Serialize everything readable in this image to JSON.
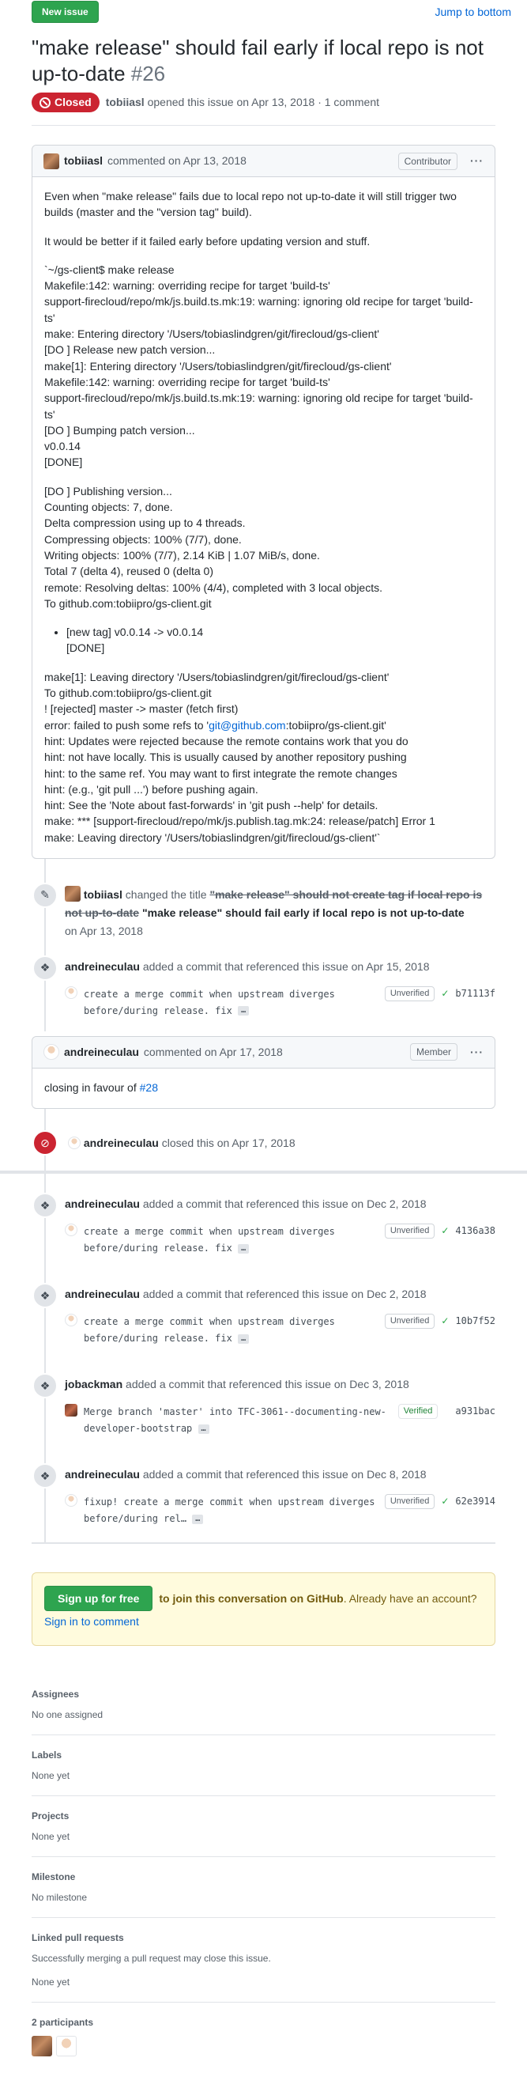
{
  "header": {
    "new_issue": "New issue",
    "jump": "Jump to bottom",
    "title": "\"make release\" should fail early if local repo is not up-to-date",
    "number": "#26",
    "state": "Closed",
    "author": "tobiiasl",
    "opened_text": "opened this issue on Apr 13, 2018 · 1 comment"
  },
  "first_comment": {
    "author": "tobiiasl",
    "action": "commented on Apr 13, 2018",
    "role": "Contributor",
    "menu": "···",
    "p1": "Even when \"make release\" fails due to local repo not up-to-date it will still trigger two builds (master and the \"version tag\" build).",
    "p2": "It would be better if it failed early before updating version and stuff.",
    "block1": [
      "`~/gs-client$ make release",
      "Makefile:142: warning: overriding recipe for target 'build-ts'",
      "support-firecloud/repo/mk/js.build.ts.mk:19: warning: ignoring old recipe for target 'build-ts'",
      "make: Entering directory '/Users/tobiaslindgren/git/firecloud/gs-client'",
      "[DO ] Release new patch version...",
      "make[1]: Entering directory '/Users/tobiaslindgren/git/firecloud/gs-client'",
      "Makefile:142: warning: overriding recipe for target 'build-ts'",
      "support-firecloud/repo/mk/js.build.ts.mk:19: warning: ignoring old recipe for target 'build-ts'",
      "[DO ] Bumping patch version...",
      "v0.0.14",
      "[DONE]"
    ],
    "block2": [
      "[DO ] Publishing version...",
      "Counting objects: 7, done.",
      "Delta compression using up to 4 threads.",
      "Compressing objects: 100% (7/7), done.",
      "Writing objects: 100% (7/7), 2.14 KiB | 1.07 MiB/s, done.",
      "Total 7 (delta 4), reused 0 (delta 0)",
      "remote: Resolving deltas: 100% (4/4), completed with 3 local objects.",
      "To github.com:tobiipro/gs-client.git"
    ],
    "bullet_line1": "[new tag] v0.0.14 -> v0.0.14",
    "bullet_line2": "[DONE]",
    "block3a": [
      "make[1]: Leaving directory '/Users/tobiaslindgren/git/firecloud/gs-client'",
      "To github.com:tobiipro/gs-client.git",
      "! [rejected] master -> master (fetch first)"
    ],
    "error_prefix": "error: failed to push some refs to '",
    "error_link": "git@github.com",
    "error_suffix": ":tobiipro/gs-client.git'",
    "block3b": [
      "hint: Updates were rejected because the remote contains work that you do",
      "hint: not have locally. This is usually caused by another repository pushing",
      "hint: to the same ref. You may want to first integrate the remote changes",
      "hint: (e.g., 'git pull ...') before pushing again.",
      "hint: See the 'Note about fast-forwards' in 'git push --help' for details.",
      "make: *** [support-firecloud/repo/mk/js.publish.tag.mk:24: release/patch] Error 1",
      "make: Leaving directory '/Users/tobiaslindgren/git/firecloud/gs-client'`"
    ]
  },
  "rename_event": {
    "author": "tobiiasl",
    "action": "changed the title",
    "old_title": "\"make release\" should not create tag if local repo is not up-to-date",
    "new_title": "\"make release\" should fail early if local repo is not up-to-date",
    "date": "on Apr 13, 2018"
  },
  "commit_events_1": [
    {
      "author": "andreineculau",
      "text": "added a commit that referenced this issue on Apr 15, 2018",
      "message": "create a merge commit when upstream diverges before/during release. fix",
      "ellipsis": "…",
      "status": "Unverified",
      "sha": "b71113f"
    }
  ],
  "second_comment": {
    "author": "andreineculau",
    "action": "commented on Apr 17, 2018",
    "role": "Member",
    "menu": "···",
    "text_prefix": "closing in favour of ",
    "link": "#28"
  },
  "closed_event": {
    "author": "andreineculau",
    "text": "closed this on Apr 17, 2018"
  },
  "commit_events_2": [
    {
      "author": "andreineculau",
      "text": "added a commit that referenced this issue on Dec 2, 2018",
      "message": "create a merge commit when upstream diverges before/during release. fix",
      "ellipsis": "…",
      "status": "Unverified",
      "sha": "4136a38"
    },
    {
      "author": "andreineculau",
      "text": "added a commit that referenced this issue on Dec 2, 2018",
      "message": "create a merge commit when upstream diverges before/during release. fix",
      "ellipsis": "…",
      "status": "Unverified",
      "sha": "10b7f52"
    },
    {
      "author": "jobackman",
      "text": "added a commit that referenced this issue on Dec 3, 2018",
      "message": "Merge branch 'master' into TFC-3061--documenting-new-developer-bootstrap",
      "ellipsis": "…",
      "status": "Verified",
      "sha": "a931bac"
    },
    {
      "author": "andreineculau",
      "text": "added a commit that referenced this issue on Dec 8, 2018",
      "message": "fixup! create a merge commit when upstream diverges before/during rel…",
      "ellipsis": "…",
      "status": "Unverified",
      "sha": "62e3914"
    }
  ],
  "signup": {
    "button": "Sign up for free",
    "text_bold": "to join this conversation on GitHub",
    "text_rest": ". Already have an account? ",
    "link": "Sign in to comment"
  },
  "sidebar": {
    "assignees_title": "Assignees",
    "assignees_value": "No one assigned",
    "labels_title": "Labels",
    "labels_value": "None yet",
    "projects_title": "Projects",
    "projects_value": "None yet",
    "milestone_title": "Milestone",
    "milestone_value": "No milestone",
    "linked_title": "Linked pull requests",
    "linked_desc": "Successfully merging a pull request may close this issue.",
    "linked_value": "None yet",
    "participants_title": "2 participants"
  }
}
